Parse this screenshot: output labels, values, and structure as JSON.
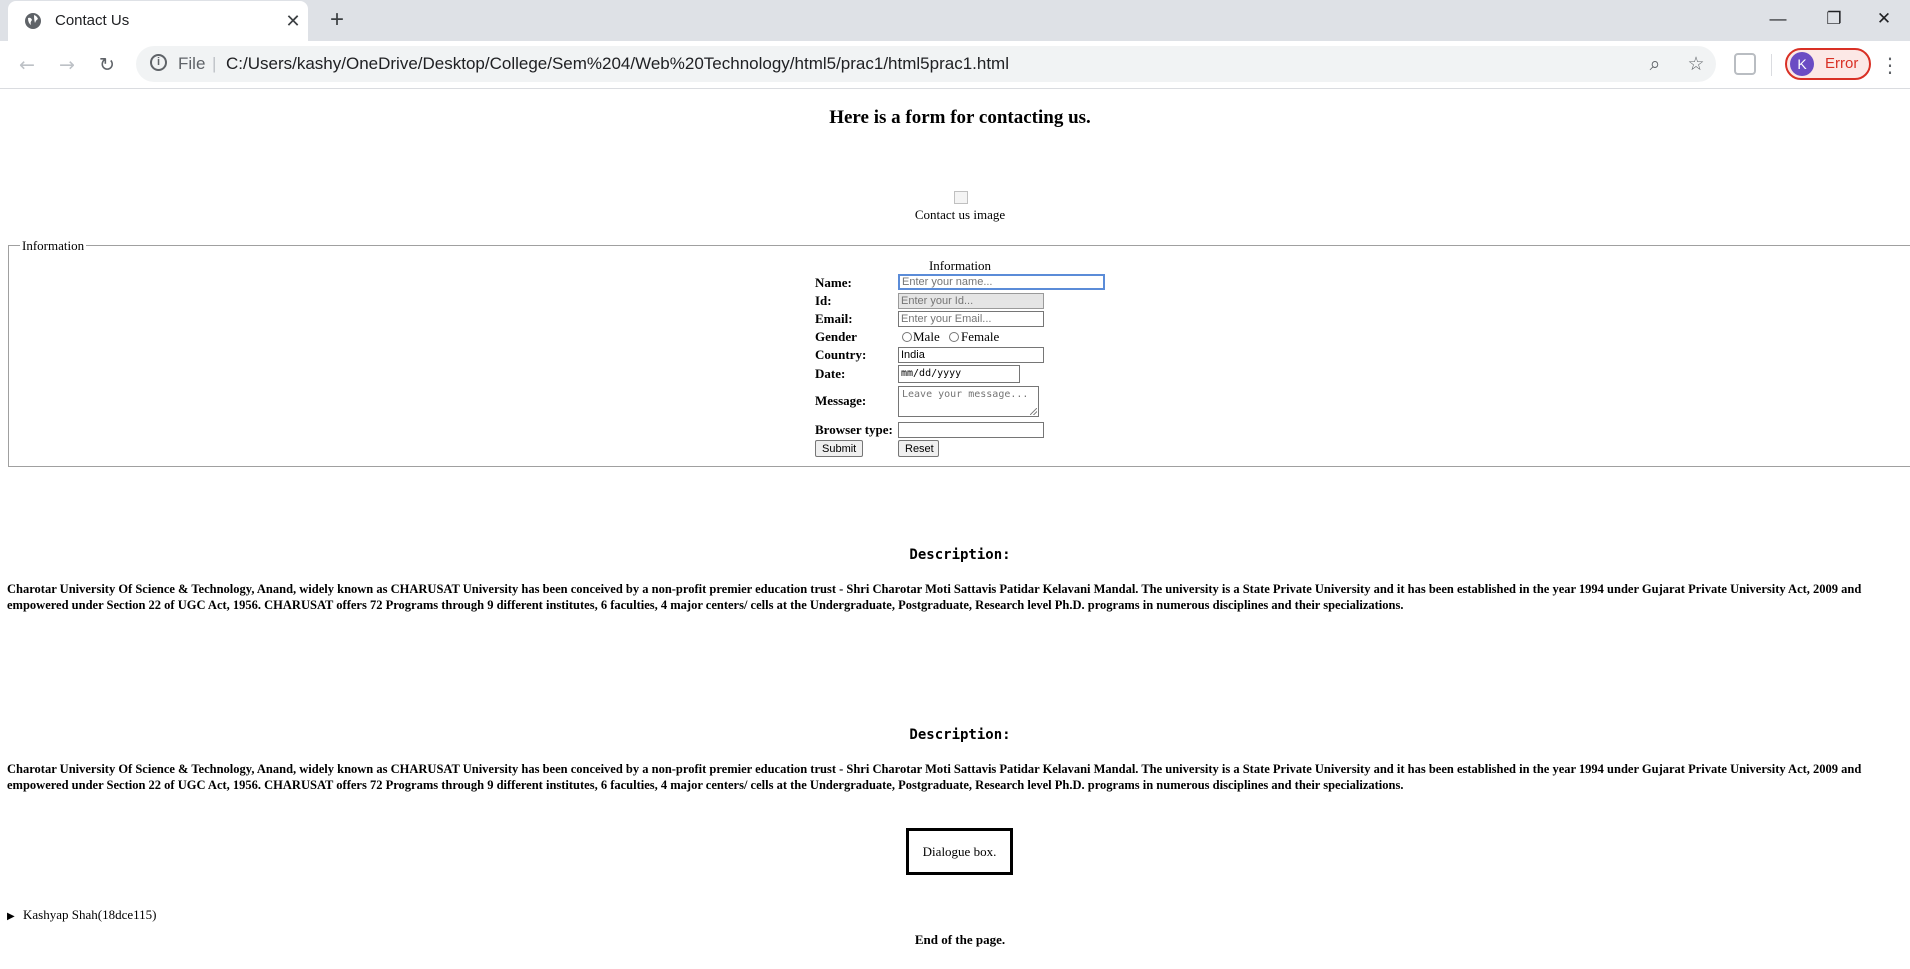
{
  "browser": {
    "tab_title": "Contact Us",
    "tab_close": "✕",
    "new_tab": "+",
    "window_controls": {
      "minimize": "—",
      "restore": "❐",
      "close": "✕"
    },
    "nav": {
      "back": "←",
      "forward": "→",
      "reload": "↻"
    },
    "file_label": "File",
    "separator": "|",
    "url": "C:/Users/kashy/OneDrive/Desktop/College/Sem%204/Web%20Technology/html5/prac1/html5prac1.html",
    "zoom_icon": "⌕",
    "bookmark_icon": "☆",
    "profile_initial": "K",
    "profile_label": "Error",
    "menu_icon": "⋮",
    "icons": [
      "globe-icon",
      "close-icon",
      "plus-icon",
      "back-arrow-icon",
      "forward-arrow-icon",
      "reload-icon",
      "info-icon",
      "zoom-out-icon",
      "star-icon",
      "extension-icon",
      "kebab-menu-icon"
    ]
  },
  "page": {
    "heading": "Here is a form for contacting us.",
    "image_alt": "Contact us image",
    "legend": "Information",
    "form_caption": "Information",
    "fields": {
      "name_label": "Name:",
      "name_placeholder": "Enter your name...",
      "id_label": "Id:",
      "id_placeholder": "Enter your Id...",
      "email_label": "Email:",
      "email_placeholder": "Enter your Email...",
      "gender_label": "Gender",
      "gender_male": "Male",
      "gender_female": "Female",
      "country_label": "Country:",
      "country_value": "India",
      "date_label": "Date:",
      "date_placeholder": "mm/dd/yyyy",
      "message_label": "Message:",
      "message_placeholder": "Leave your message...",
      "browser_label": "Browser type:",
      "browser_value": ""
    },
    "submit_label": "Submit",
    "reset_label": "Reset",
    "descriptions": [
      {
        "title": "Description:",
        "text": "Charotar University Of Science & Technology, Anand, widely known as CHARUSAT University has been conceived by a non-profit premier education trust - Shri Charotar Moti Sattavis Patidar Kelavani Mandal. The university is a State Private University and it has been established in the year 1994 under Gujarat Private University Act, 2009 and empowered under Section 22 of UGC Act, 1956. CHARUSAT offers 72 Programs through 9 different institutes, 6 faculties, 4 major centers/ cells at the Undergraduate, Postgraduate, Research level Ph.D. programs in numerous disciplines and their specializations."
      },
      {
        "title": "Description:",
        "text": "Charotar University Of Science & Technology, Anand, widely known as CHARUSAT University has been conceived by a non-profit premier education trust - Shri Charotar Moti Sattavis Patidar Kelavani Mandal. The university is a State Private University and it has been established in the year 1994 under Gujarat Private University Act, 2009 and empowered under Section 22 of UGC Act, 1956. CHARUSAT offers 72 Programs through 9 different institutes, 6 faculties, 4 major centers/ cells at the Undergraduate, Postgraduate, Research level Ph.D. programs in numerous disciplines and their specializations."
      }
    ],
    "dialog_text": "Dialogue box.",
    "details_summary": "Kashyap Shah(18dce115)",
    "details_marker": "▶",
    "end_text": "End of the page."
  }
}
